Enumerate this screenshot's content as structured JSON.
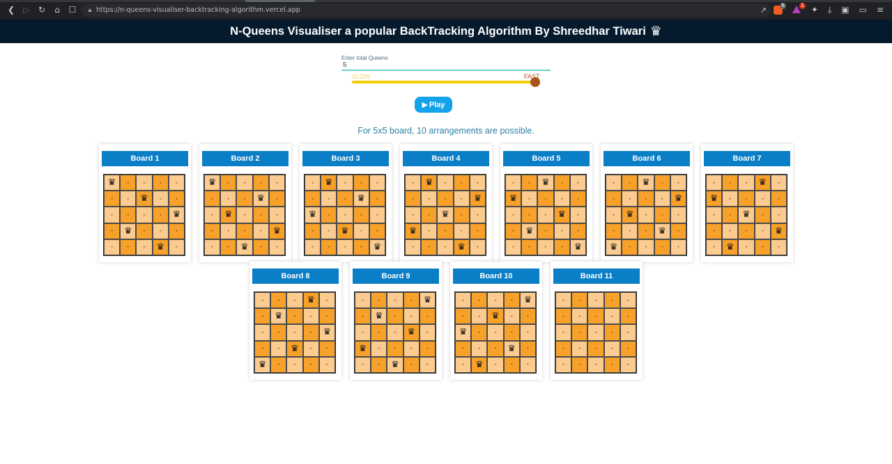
{
  "browser": {
    "url": "https://n-queens-visualiser-backtracking-algorithm.vercel.app",
    "brave_badge": "6",
    "rewards_badge": "1"
  },
  "header": {
    "title": "N-Queens Visualiser a popular BackTracking Algorithm By Shreedhar Tiwari",
    "crown_icon": "crown-icon"
  },
  "controls": {
    "queens_label": "Enter total Queens",
    "queens_value": "5",
    "speed_slow": "SLOW",
    "speed_fast": "FAST",
    "speed_level": 1.0,
    "play_label": "Play"
  },
  "summary": "For 5x5 board, 10 arrangements are possible.",
  "colors": {
    "light": "#fccb8f",
    "dark": "#f7a12a",
    "board_header": "#0a7ec6",
    "header_bg": "#051a2c"
  },
  "boards": [
    {
      "title": "Board 1",
      "queens": [
        0,
        2,
        4,
        1,
        3
      ]
    },
    {
      "title": "Board 2",
      "queens": [
        0,
        3,
        1,
        4,
        2
      ]
    },
    {
      "title": "Board 3",
      "queens": [
        1,
        3,
        0,
        2,
        4
      ]
    },
    {
      "title": "Board 4",
      "queens": [
        1,
        4,
        2,
        0,
        3
      ]
    },
    {
      "title": "Board 5",
      "queens": [
        2,
        0,
        3,
        1,
        4
      ]
    },
    {
      "title": "Board 6",
      "queens": [
        2,
        4,
        1,
        3,
        0
      ]
    },
    {
      "title": "Board 7",
      "queens": [
        3,
        0,
        2,
        4,
        1
      ]
    },
    {
      "title": "Board 8",
      "queens": [
        3,
        1,
        4,
        2,
        0
      ]
    },
    {
      "title": "Board 9",
      "queens": [
        4,
        1,
        3,
        0,
        2
      ]
    },
    {
      "title": "Board 10",
      "queens": [
        4,
        2,
        0,
        3,
        1
      ]
    },
    {
      "title": "Board 11",
      "queens": [
        -1,
        -1,
        -1,
        -1,
        -1
      ]
    }
  ]
}
